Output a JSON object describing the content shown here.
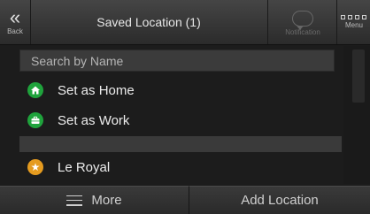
{
  "header": {
    "back_label": "Back",
    "title": "Saved Location (1)",
    "notification_label": "Notification",
    "menu_label": "Menu"
  },
  "search": {
    "placeholder": "Search by Name",
    "value": ""
  },
  "list": {
    "items": [
      {
        "label": "Set as Home",
        "icon": "home-icon",
        "color": "#1fa33c"
      },
      {
        "label": "Set as Work",
        "icon": "briefcase-icon",
        "color": "#1fa33c"
      },
      {
        "label": "Le Royal",
        "icon": "star-icon",
        "color": "#e59b1f"
      }
    ]
  },
  "footer": {
    "more_label": "More",
    "add_label": "Add Location"
  }
}
